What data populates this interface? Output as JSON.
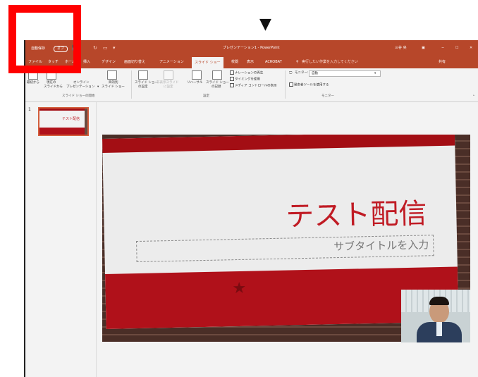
{
  "arrow": "▼",
  "titlebar": {
    "autosave": "自動保存",
    "autosave_state": "オフ",
    "document_title": "プレゼンテーション1 - PowerPoint",
    "user": "三谷 央"
  },
  "tabs": [
    "ファイル",
    "タッチ",
    "ホーム",
    "挿入",
    "デザイン",
    "画面切り替え",
    "アニメーション",
    "スライド ショー",
    "校閲",
    "表示",
    "ACROBAT"
  ],
  "active_tab": "スライド ショー",
  "tell_me": "実行したい作業を入力してください",
  "share": "共有",
  "ribbon": {
    "start": {
      "from_beginning": "最初から",
      "from_current_1": "現在の",
      "from_current_2": "スライドから",
      "online_1": "オンライン",
      "online_2": "プレゼンテーション",
      "custom_1": "目的別",
      "custom_2": "スライド ショー",
      "group_label": "スライド ショーの開始"
    },
    "setup": {
      "setup_1": "スライド ショー",
      "setup_2": "の設定",
      "hide_1": "非表示スライド",
      "hide_2": "に設定",
      "rehearse": "リハーサル",
      "record_1": "スライド ショー",
      "record_2": "の記録",
      "narration": "ナレーションの再生",
      "timing": "タイミングを使用",
      "media": "メディア コントロールの表示",
      "group_label": "設定"
    },
    "monitors": {
      "monitor_label": "モニター:",
      "monitor_value": "自動",
      "presenter_view": "発表者ツールを使用する",
      "group_label": "モニター"
    }
  },
  "thumbnail": {
    "number": "1",
    "title": "テスト配信"
  },
  "slide": {
    "title": "テスト配信",
    "subtitle": "サブタイトルを入力"
  }
}
